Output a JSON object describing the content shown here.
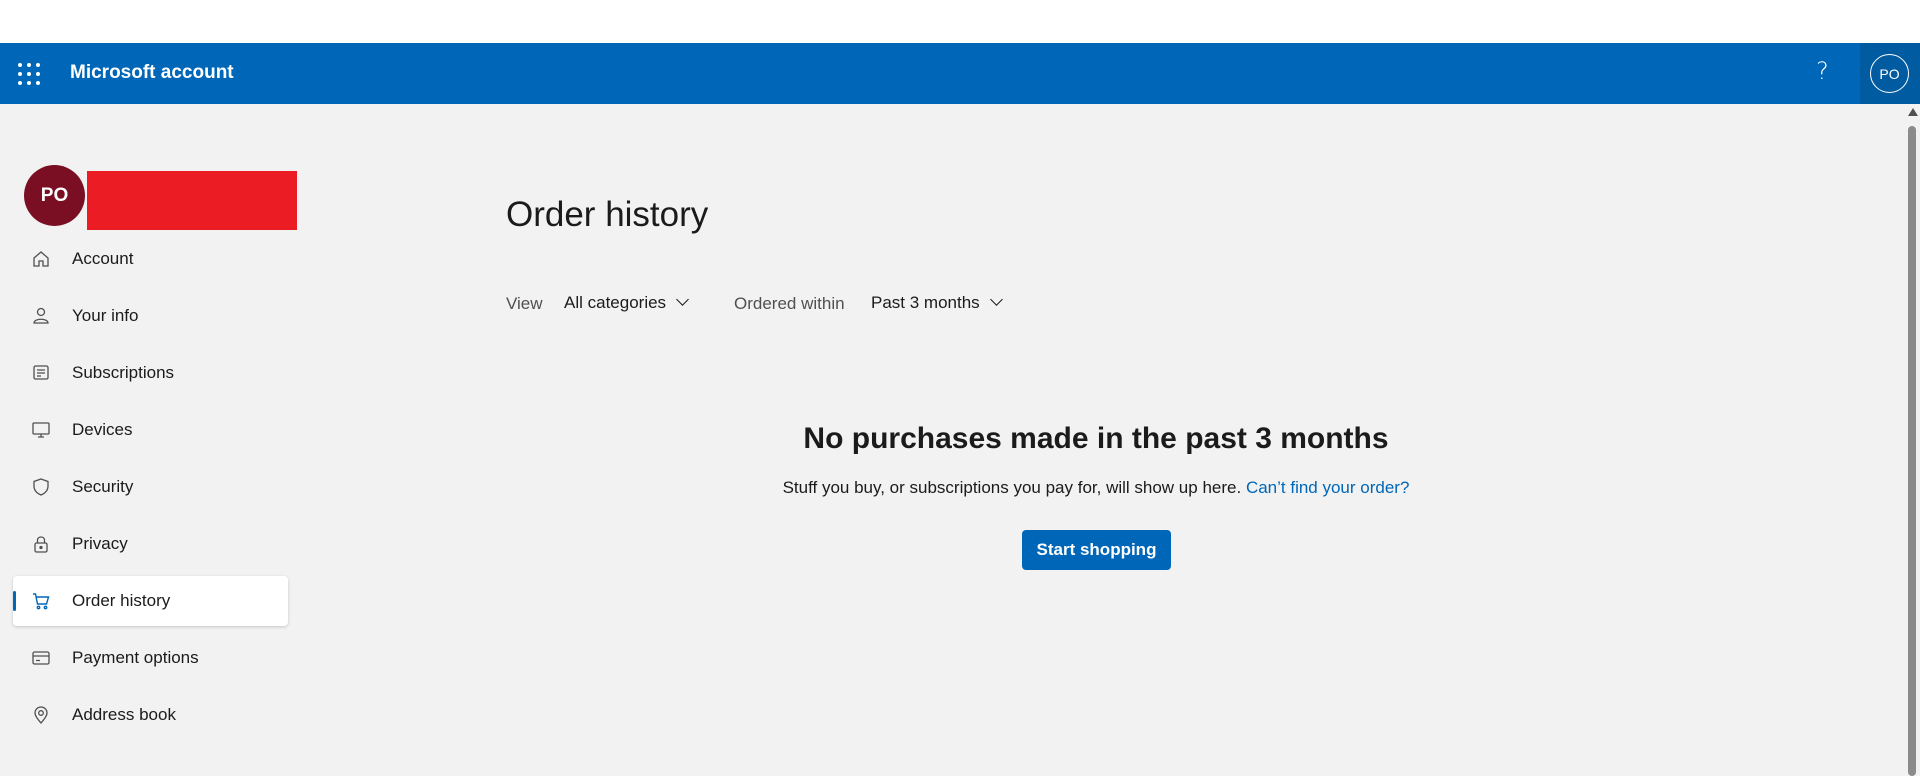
{
  "header": {
    "app_title": "Microsoft account",
    "help_symbol": "?",
    "avatar_initials": "PO",
    "brand_color": "#0067b8"
  },
  "profile": {
    "initials": "PO",
    "avatar_color": "#7a0f24"
  },
  "sidebar": {
    "items": [
      {
        "label": "Account",
        "icon": "home-icon"
      },
      {
        "label": "Your info",
        "icon": "person-icon"
      },
      {
        "label": "Subscriptions",
        "icon": "subscriptions-icon"
      },
      {
        "label": "Devices",
        "icon": "monitor-icon"
      },
      {
        "label": "Security",
        "icon": "shield-icon"
      },
      {
        "label": "Privacy",
        "icon": "lock-icon"
      },
      {
        "label": "Order history",
        "icon": "cart-icon",
        "active": true
      },
      {
        "label": "Payment options",
        "icon": "credit-card-icon"
      },
      {
        "label": "Address book",
        "icon": "location-pin-icon"
      }
    ]
  },
  "main": {
    "title": "Order history",
    "filters": {
      "view_label": "View",
      "view_value": "All categories",
      "ordered_within_label": "Ordered within",
      "ordered_within_value": "Past 3 months"
    },
    "empty_state": {
      "title": "No purchases made in the past 3 months",
      "description": "Stuff you buy, or subscriptions you pay for, will show up here.",
      "link_text": "Can’t find your order?",
      "button_label": "Start shopping"
    }
  }
}
